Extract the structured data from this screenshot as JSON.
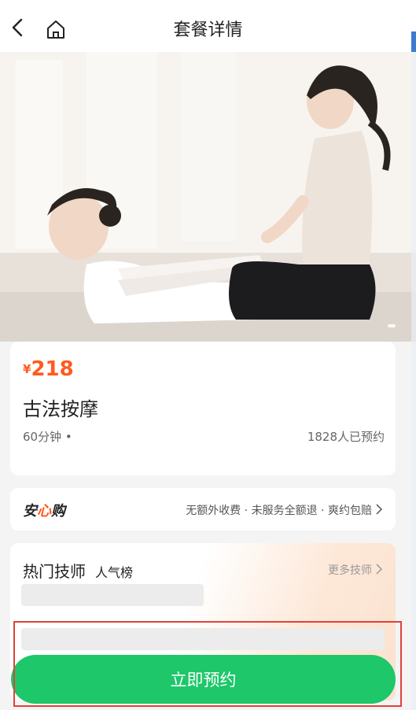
{
  "header": {
    "title": "套餐详情",
    "back_icon": "chevron-left-icon",
    "home_icon": "home-icon"
  },
  "hero": {
    "image": "therapist stretching client's arms on a floor mat"
  },
  "package": {
    "currency": "¥",
    "price": "218",
    "name": "古法按摩",
    "duration": "60分钟 •",
    "booked_count": "1828人已预约"
  },
  "guarantee": {
    "logo_part1": "安",
    "logo_part2": "心",
    "logo_part3": "购",
    "text": "无额外收费 · 未服务全额退 · 爽约包赔"
  },
  "technicians": {
    "title": "热门技师",
    "subtitle": "人气榜",
    "more": "更多技师"
  },
  "cta": {
    "label": "立即预约",
    "color": "#1dc76a"
  },
  "colors": {
    "accent": "#ff5a1f",
    "highlight": "#e0423a"
  }
}
